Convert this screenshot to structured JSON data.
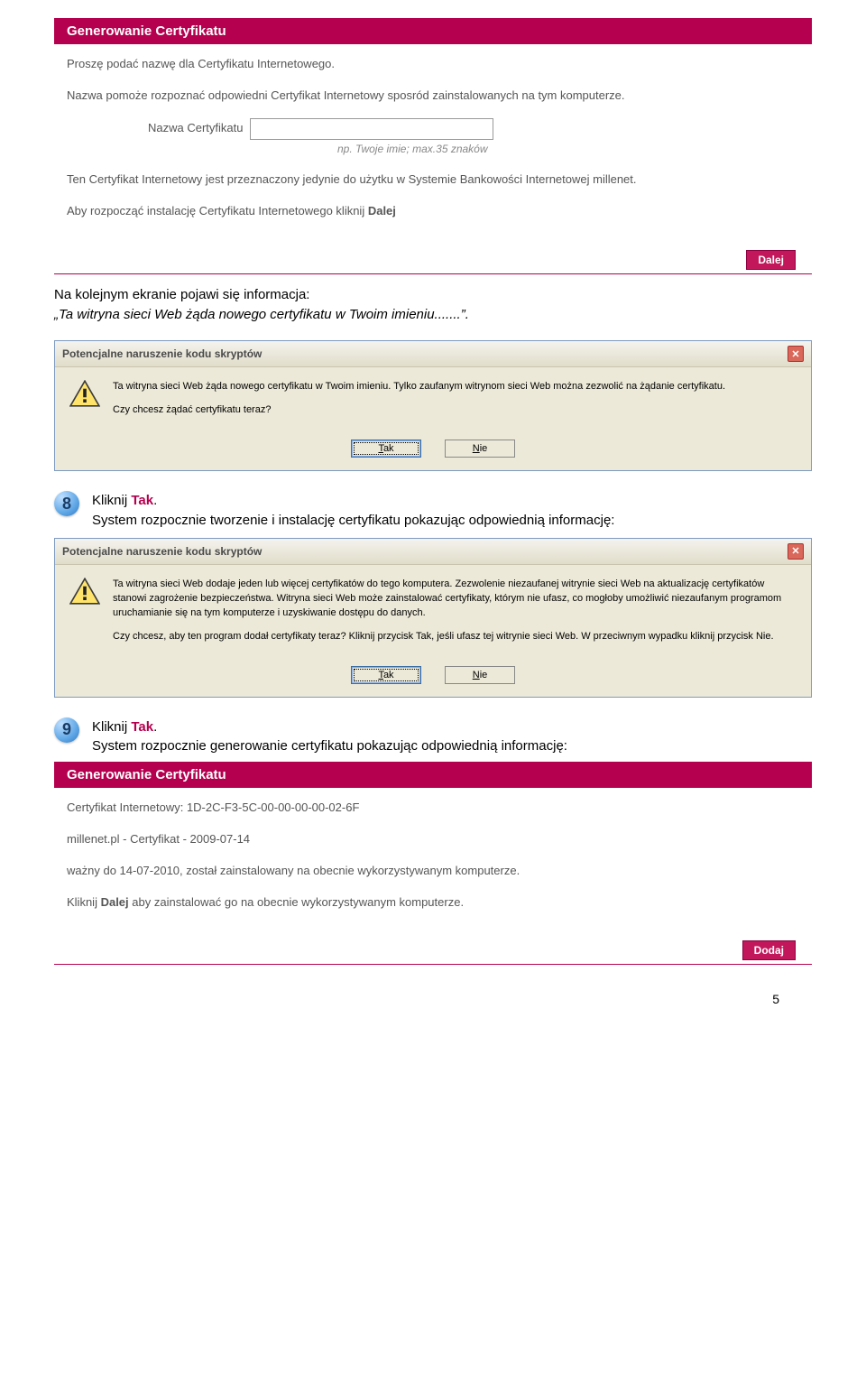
{
  "panel1": {
    "title": "Generowanie Certyfikatu",
    "p1": "Proszę podać nazwę dla Certyfikatu Internetowego.",
    "p2": "Nazwa pomoże rozpoznać odpowiedni Certyfikat Internetowy sposród zainstalowanych na tym komputerze.",
    "cert_label": "Nazwa Certyfikatu",
    "cert_hint": "np. Twoje imie; max.35 znaków",
    "p3": "Ten Certyfikat Internetowy jest przeznaczony jedynie do użytku w Systemie Bankowości Internetowej millenet.",
    "p4_a": "Aby rozpocząć instalację Certyfikatu Internetowego kliknij ",
    "p4_b": "Dalej",
    "btn": "Dalej"
  },
  "afterPanel1": {
    "line1": "Na kolejnym ekranie pojawi się informacja:",
    "line2": "„Ta witryna sieci Web żąda nowego certyfikatu w Twoim imieniu.......”."
  },
  "dialog1": {
    "title": "Potencjalne naruszenie kodu skryptów",
    "msg1": "Ta witryna sieci Web żąda nowego certyfikatu w Twoim imieniu. Tylko zaufanym witrynom sieci Web można zezwolić na żądanie certyfikatu.",
    "msg2": "Czy chcesz żądać certyfikatu teraz?",
    "yes": "Tak",
    "no": "Nie"
  },
  "step8": {
    "num": "8",
    "a": "Kliknij ",
    "tak": "Tak",
    "b": ".",
    "line2": "System rozpocznie tworzenie i instalację certyfikatu pokazując odpowiednią informację:"
  },
  "dialog2": {
    "title": "Potencjalne naruszenie kodu skryptów",
    "msg1": "Ta witryna sieci Web dodaje jeden lub więcej certyfikatów do tego komputera. Zezwolenie niezaufanej witrynie sieci Web na aktualizację certyfikatów stanowi zagrożenie bezpieczeństwa. Witryna sieci Web może zainstalować certyfikaty, którym nie ufasz, co mogłoby umożliwić niezaufanym programom uruchamianie się na tym komputerze i uzyskiwanie dostępu do danych.",
    "msg2": "Czy chcesz, aby ten program dodał certyfikaty teraz? Kliknij przycisk Tak, jeśli ufasz tej witrynie sieci Web. W przeciwnym wypadku kliknij przycisk Nie.",
    "yes": "Tak",
    "no": "Nie"
  },
  "step9": {
    "num": "9",
    "a": "Kliknij ",
    "tak": "Tak",
    "b": ".",
    "line2": "System rozpocznie generowanie certyfikatu pokazując odpowiednią informację:"
  },
  "panel2": {
    "title": "Generowanie Certyfikatu",
    "p1": "Certyfikat Internetowy: 1D-2C-F3-5C-00-00-00-00-02-6F",
    "p2": "millenet.pl - Certyfikat - 2009-07-14",
    "p3": "ważny do 14-07-2010, został zainstalowany na obecnie wykorzystywanym komputerze.",
    "p4_a": "Kliknij ",
    "p4_b": "Dalej",
    "p4_c": " aby zainstalować go na obecnie wykorzystywanym komputerze.",
    "btn": "Dodaj"
  },
  "pageNumber": "5"
}
